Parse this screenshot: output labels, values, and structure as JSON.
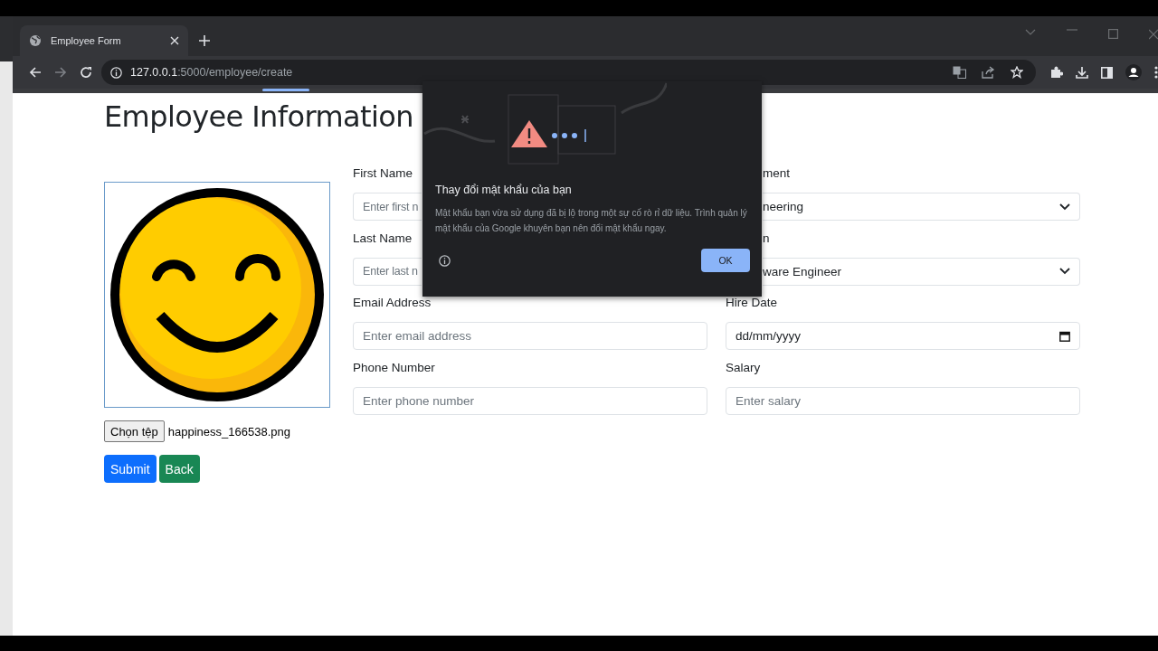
{
  "browser": {
    "tab": {
      "title": "Employee Form"
    },
    "url": {
      "host": "127.0.0.1",
      "path": ":5000/employee/create"
    },
    "forward_disabled": true
  },
  "page": {
    "heading": "Employee Information",
    "file_input": {
      "button": "Chọn tệp",
      "filename": "happiness_166538.png"
    },
    "columns": [
      [
        {
          "kind": "text",
          "label": "First Name",
          "placeholder": "Enter first n",
          "covered": true
        },
        {
          "kind": "text",
          "label": "Last Name",
          "placeholder": "Enter last n",
          "covered": true
        },
        {
          "kind": "text",
          "label": "Email Address",
          "placeholder": "Enter email address",
          "covered": false
        },
        {
          "kind": "text",
          "label": "Phone Number",
          "placeholder": "Enter phone number",
          "covered": false
        }
      ],
      [
        {
          "kind": "select",
          "label": "ment",
          "value": "neering",
          "covered": true
        },
        {
          "kind": "select",
          "label": "n",
          "value": "ware Engineer",
          "covered": true
        },
        {
          "kind": "date",
          "label": "Hire Date",
          "value": "dd/mm/yyyy",
          "covered": false
        },
        {
          "kind": "text",
          "label": "Salary",
          "placeholder": "Enter salary",
          "covered": false
        }
      ]
    ],
    "buttons": [
      {
        "kind": "primary",
        "label": "Submit"
      },
      {
        "kind": "success",
        "label": "Back"
      }
    ]
  },
  "dialog": {
    "title": "Thay đổi mật khẩu của bạn",
    "message": "Mật khẩu bạn vừa sử dụng đã bị lộ trong một sự cố rò rỉ dữ liệu. Trình quản lý mật khẩu của Google khuyên bạn nên đổi mật khẩu ngay.",
    "button": "OK"
  }
}
